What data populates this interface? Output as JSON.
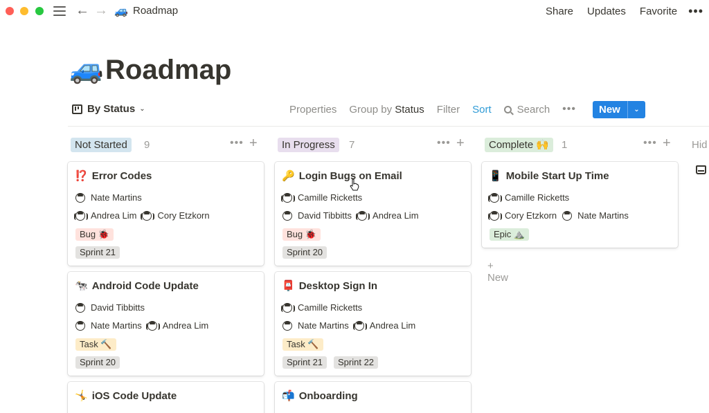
{
  "titlebar": {
    "breadcrumb_emoji": "🚙",
    "breadcrumb_title": "Roadmap",
    "actions": [
      "Share",
      "Updates",
      "Favorite"
    ],
    "more": "•••"
  },
  "page": {
    "emoji": "🚙",
    "title": "Roadmap"
  },
  "viewbar": {
    "view_name": "By Status",
    "properties": "Properties",
    "group_by_prefix": "Group by",
    "group_by_value": "Status",
    "filter": "Filter",
    "sort": "Sort",
    "search": "Search",
    "more": "•••",
    "new_label": "New"
  },
  "columns": [
    {
      "status": "Not Started",
      "count": "9",
      "color": "#d3e5ef",
      "cards": [
        {
          "emoji": "⁉️",
          "title": "Error Codes",
          "people_rows": [
            [
              "Nate Martins"
            ],
            [
              "Andrea Lim",
              "Cory Etzkorn"
            ]
          ],
          "tags": [
            {
              "label": "Bug 🐞",
              "kind": "bug"
            }
          ],
          "sprints": [
            "Sprint 21"
          ]
        },
        {
          "emoji": "🐄",
          "title": "Android Code Update",
          "people_rows": [
            [
              "David Tibbitts"
            ],
            [
              "Nate Martins",
              "Andrea Lim"
            ]
          ],
          "tags": [
            {
              "label": "Task 🔨",
              "kind": "task"
            }
          ],
          "sprints": [
            "Sprint 20"
          ]
        },
        {
          "emoji": "🤸",
          "title": "iOS Code Update"
        }
      ]
    },
    {
      "status": "In Progress",
      "count": "7",
      "color": "#e8deee",
      "cards": [
        {
          "emoji": "🔑",
          "title": "Login Bugs on Email",
          "people_rows": [
            [
              "Camille Ricketts"
            ],
            [
              "David Tibbitts",
              "Andrea Lim"
            ]
          ],
          "tags": [
            {
              "label": "Bug 🐞",
              "kind": "bug"
            }
          ],
          "sprints": [
            "Sprint 20"
          ]
        },
        {
          "emoji": "📮",
          "title": "Desktop Sign In",
          "people_rows": [
            [
              "Camille Ricketts"
            ],
            [
              "Nate Martins",
              "Andrea Lim"
            ]
          ],
          "tags": [
            {
              "label": "Task 🔨",
              "kind": "task"
            }
          ],
          "sprints": [
            "Sprint 21",
            "Sprint 22"
          ]
        },
        {
          "emoji": "📬",
          "title": "Onboarding"
        }
      ]
    },
    {
      "status": "Complete 🙌",
      "count": "1",
      "color": "#dbeddb",
      "cards": [
        {
          "emoji": "📱",
          "title": "Mobile Start Up Time",
          "people_rows": [
            [
              "Camille Ricketts"
            ],
            [
              "Cory Etzkorn",
              "Nate Martins"
            ]
          ],
          "tags": [
            {
              "label": "Epic ⛰️",
              "kind": "epic"
            }
          ],
          "sprints": []
        }
      ],
      "add_new": "+ New"
    }
  ],
  "hidden_column_label": "Hid"
}
